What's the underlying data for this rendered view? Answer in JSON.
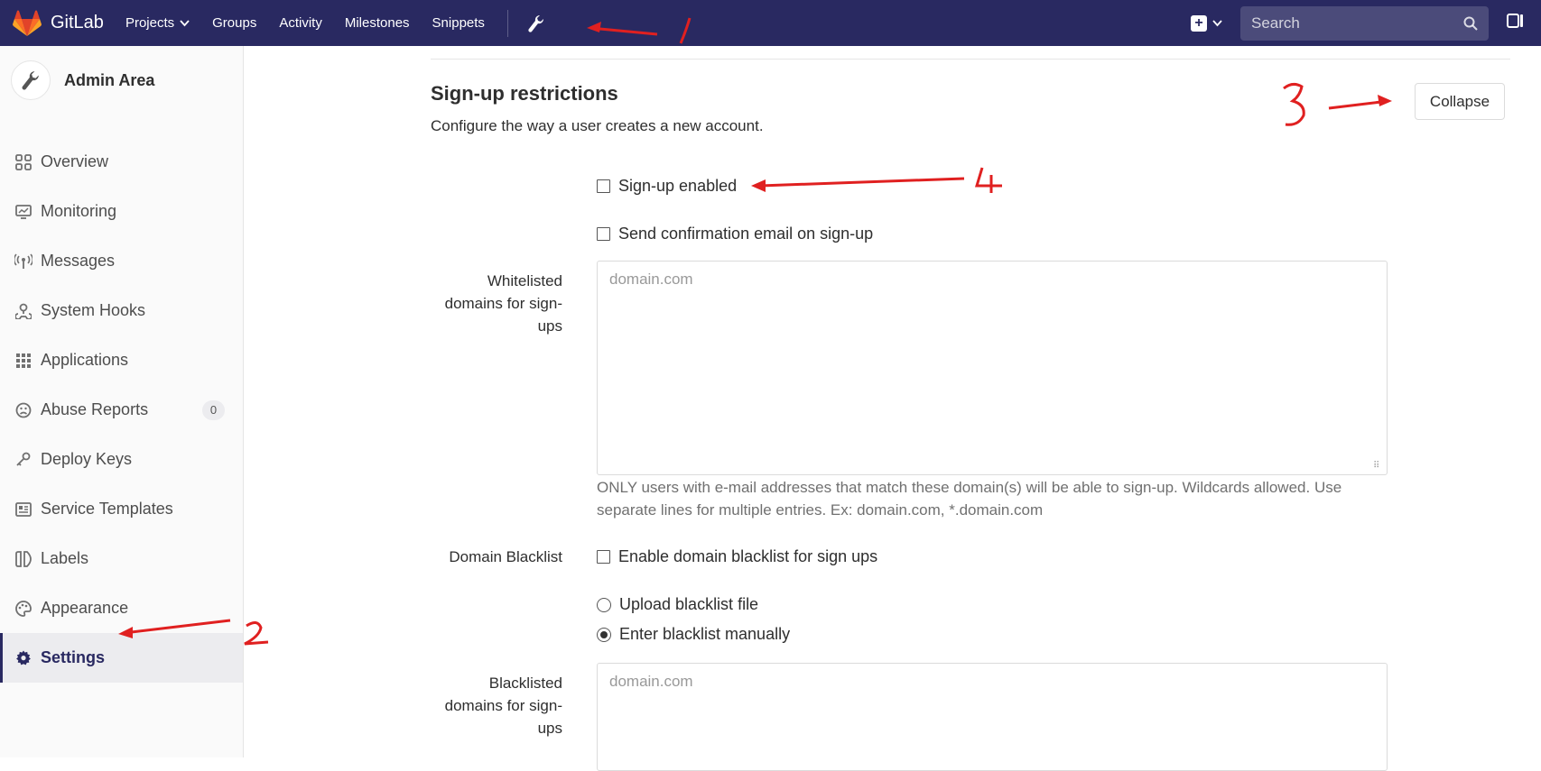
{
  "brand": {
    "name": "GitLab"
  },
  "nav": {
    "links": [
      "Projects",
      "Groups",
      "Activity",
      "Milestones",
      "Snippets"
    ],
    "search_placeholder": "Search"
  },
  "sidebar": {
    "title": "Admin Area",
    "items": [
      {
        "label": "Overview",
        "icon": "grid-icon"
      },
      {
        "label": "Monitoring",
        "icon": "monitor-icon"
      },
      {
        "label": "Messages",
        "icon": "broadcast-icon"
      },
      {
        "label": "System Hooks",
        "icon": "hook-icon"
      },
      {
        "label": "Applications",
        "icon": "apps-icon"
      },
      {
        "label": "Abuse Reports",
        "icon": "frown-icon",
        "badge": "0"
      },
      {
        "label": "Deploy Keys",
        "icon": "key-icon"
      },
      {
        "label": "Service Templates",
        "icon": "template-icon"
      },
      {
        "label": "Labels",
        "icon": "labels-icon"
      },
      {
        "label": "Appearance",
        "icon": "palette-icon"
      },
      {
        "label": "Settings",
        "icon": "gear-icon",
        "active": true
      }
    ]
  },
  "section": {
    "title": "Sign-up restrictions",
    "description": "Configure the way a user creates a new account.",
    "collapse_label": "Collapse",
    "signup_enabled_label": "Sign-up enabled",
    "confirm_email_label": "Send confirmation email on sign-up",
    "whitelist_label": "Whitelisted domains for sign-ups",
    "whitelist_placeholder": "domain.com",
    "whitelist_help": "ONLY users with e-mail addresses that match these domain(s) will be able to sign-up. Wildcards allowed. Use separate lines for multiple entries. Ex: domain.com, *.domain.com",
    "blacklist_label": "Domain Blacklist",
    "blacklist_enable_label": "Enable domain blacklist for sign ups",
    "upload_file_label": "Upload blacklist file",
    "enter_manual_label": "Enter blacklist manually",
    "blacklisted_label": "Blacklisted domains for sign-ups",
    "blacklisted_placeholder": "domain.com"
  },
  "annotations": {
    "colors": {
      "annotation": "#e02020"
    }
  },
  "colors": {
    "nav_bg": "#292961",
    "sidebar_bg": "#fafafa",
    "active_item_bg": "#ececef"
  }
}
